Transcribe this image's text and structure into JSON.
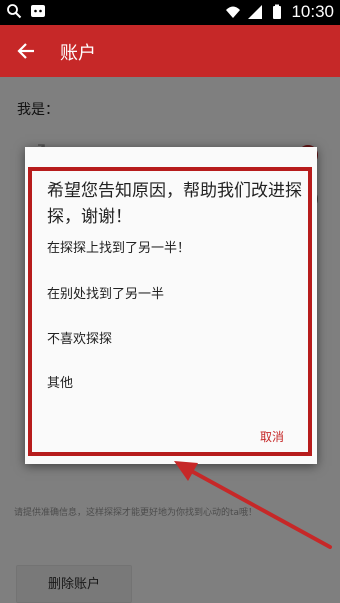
{
  "status_bar": {
    "time": "10:30"
  },
  "app_bar": {
    "title": "账户"
  },
  "page": {
    "gender_label": "我是：",
    "male_label": "男",
    "hint": "请提供准确信息，这样探探才能更好地为你找到心动的ta哦！",
    "delete_account": "删除账户"
  },
  "dialog": {
    "title": "希望您告知原因，帮助我们改进探探，谢谢！",
    "options": [
      "在探探上找到了另一半！",
      "在别处找到了另一半",
      "不喜欢探探",
      "其他"
    ],
    "cancel": "取消"
  },
  "colors": {
    "accent": "#c62828",
    "highlight": "#b71c1c"
  }
}
